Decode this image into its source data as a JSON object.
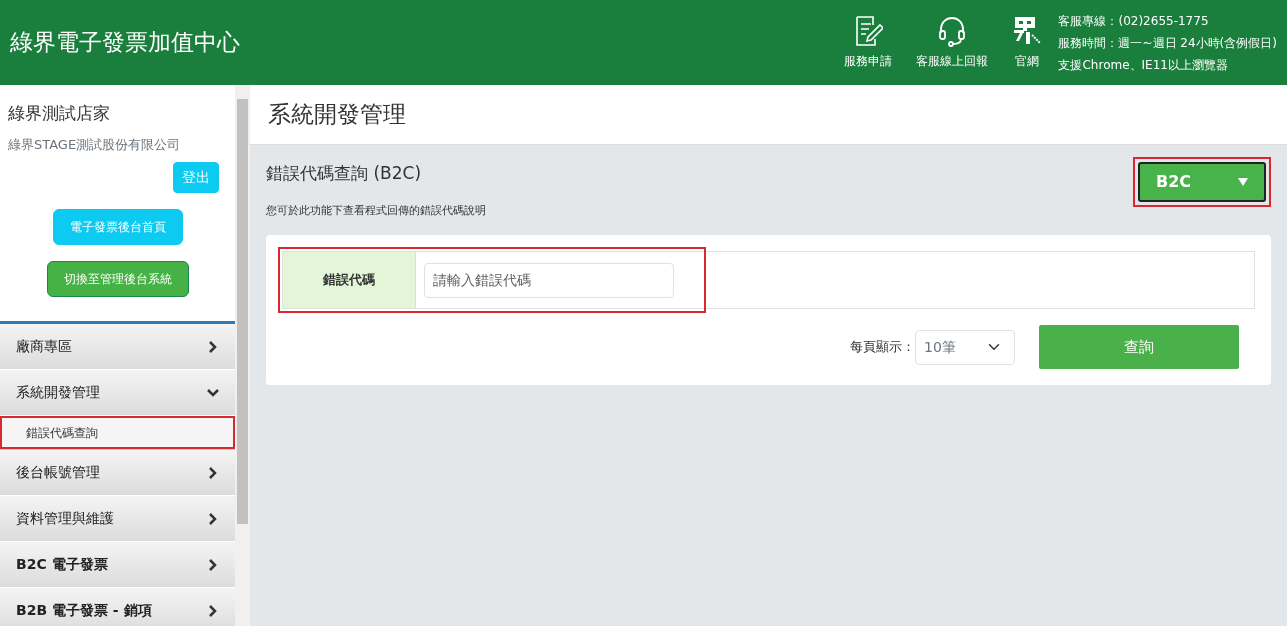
{
  "header": {
    "title": "綠界電子發票加值中心",
    "links": [
      {
        "kind": "form",
        "label": "服務申請"
      },
      {
        "kind": "headset",
        "label": "客服線上回報"
      },
      {
        "kind": "site",
        "label": "官網"
      }
    ],
    "info": [
      "客服專線：(02)2655-1775",
      "服務時間：週一~週日 24小時(含例假日)",
      "支援Chrome、IE11以上瀏覽器"
    ]
  },
  "sidebar": {
    "store": "綠界測試店家",
    "company": "綠界STAGE測試股份有限公司",
    "logout": "登出",
    "buttons": [
      {
        "kind": "info",
        "label": "電子發票後台首頁"
      },
      {
        "kind": "success",
        "label": "切換至管理後台系統"
      }
    ],
    "menu": [
      {
        "label": "廠商專區",
        "expanded": false
      },
      {
        "label": "系統開發管理",
        "expanded": true,
        "children": [
          {
            "label": "錯誤代碼查詢",
            "highlighted": true
          }
        ]
      },
      {
        "label": "後台帳號管理",
        "expanded": false
      },
      {
        "label": "資料管理與維護",
        "expanded": false
      },
      {
        "label": "B2C 電子發票",
        "expanded": false
      },
      {
        "label": "B2B 電子發票 - 銷項",
        "expanded": false
      }
    ]
  },
  "page": {
    "title": "系統開發管理",
    "subtitle": "錯誤代碼查詢 (B2C)",
    "description": "您可於此功能下查看程式回傳的錯誤代碼說明",
    "type_select": {
      "value": "B2C",
      "highlighted": true
    },
    "field": {
      "label": "錯誤代碼",
      "placeholder": "請輸入錯誤代碼",
      "highlighted": true
    },
    "per_page": {
      "label": "每頁顯示：",
      "value": "10筆"
    },
    "search_button": "查詢"
  }
}
